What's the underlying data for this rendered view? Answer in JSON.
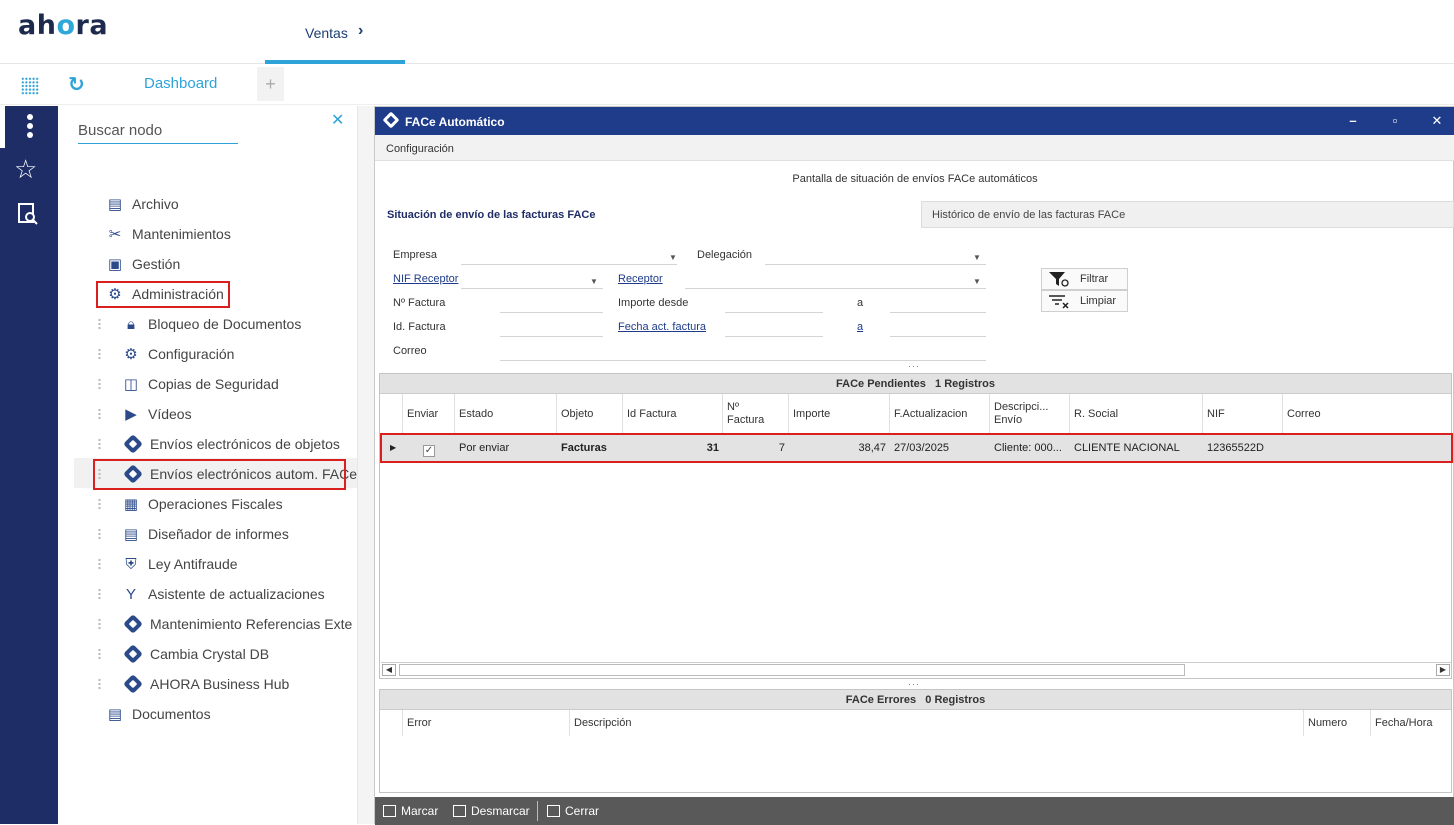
{
  "app": {
    "logo": "ahora"
  },
  "topbar": {
    "tab_label": "Ventas"
  },
  "secbar": {
    "dashboard_label": "Dashboard",
    "add_tab": "+"
  },
  "tree": {
    "search_placeholder": "Buscar nodo",
    "items": [
      {
        "label": "Archivo",
        "icon": "document-icon"
      },
      {
        "label": "Mantenimientos",
        "icon": "tools-icon"
      },
      {
        "label": "Gestión",
        "icon": "clipboard-icon"
      },
      {
        "label": "Administración",
        "icon": "admin-icon"
      },
      {
        "label": "Bloqueo de Documentos",
        "icon": "lock-icon"
      },
      {
        "label": "Configuración",
        "icon": "gear-icon"
      },
      {
        "label": "Copias de Seguridad",
        "icon": "backup-icon"
      },
      {
        "label": "Vídeos",
        "icon": "video-icon"
      },
      {
        "label": "Envíos electrónicos de objetos",
        "icon": "ahora-diamond-icon"
      },
      {
        "label": "Envíos electrónicos autom. FACe",
        "icon": "ahora-diamond-icon"
      },
      {
        "label": "Operaciones Fiscales",
        "icon": "calculator-icon"
      },
      {
        "label": "Diseñador de informes",
        "icon": "report-icon"
      },
      {
        "label": "Ley Antifraude",
        "icon": "antifraud-icon"
      },
      {
        "label": "Asistente de actualizaciones",
        "icon": "fork-icon"
      },
      {
        "label": "Mantenimiento Referencias Externas",
        "icon": "ahora-diamond-icon"
      },
      {
        "label": "Cambia Crystal DB",
        "icon": "ahora-diamond-icon"
      },
      {
        "label": "AHORA Business Hub",
        "icon": "ahora-diamond-icon"
      },
      {
        "label": "Documentos",
        "icon": "document-icon"
      }
    ]
  },
  "window": {
    "title": "FACe Automático",
    "menu": "Configuración",
    "subtitle": "Pantalla de situación de envíos FACe automáticos",
    "tab_active": "Situación de envío de las facturas FACe",
    "tab_other": "Histórico de envío de las facturas FACe",
    "filters": {
      "empresa": "Empresa",
      "delegacion": "Delegación",
      "nif_receptor": "NIF Receptor",
      "receptor": "Receptor",
      "n_factura": "Nº Factura",
      "importe_desde": "Importe desde",
      "a1": "a",
      "id_factura": "Id. Factura",
      "fecha_act": "Fecha act. factura",
      "a2": "a",
      "correo": "Correo",
      "filtrar": "Filtrar",
      "limpiar": "Limpiar"
    },
    "pendientes": {
      "title": "FACe Pendientes",
      "count": "1 Registros",
      "columns": [
        "Enviar",
        "Estado",
        "Objeto",
        "Id Factura",
        "Nº Factura",
        "Importe",
        "F.Actualizacion",
        "Descripción Envío",
        "R. Social",
        "NIF",
        "Correo"
      ],
      "column_labels": [
        "Enviar",
        "Estado",
        "Objeto",
        "Id Factura",
        "Nº\nFactura",
        "Importe",
        "F.Actualizacion",
        "Descripci...\nEnvío",
        "R. Social",
        "NIF",
        "Correo"
      ],
      "rows": [
        {
          "enviar": "✓",
          "estado": "Por enviar",
          "objeto": "Facturas",
          "id_factura": "31",
          "n_factura": "7",
          "importe": "38,47",
          "f_actualizacion": "27/03/2025",
          "descripcion": "Cliente: 000...",
          "r_social": "CLIENTE NACIONAL",
          "nif": "12365522D",
          "correo": ""
        }
      ]
    },
    "errores": {
      "title": "FACe Errores",
      "count": "0 Registros",
      "columns": [
        "Error",
        "Descripción",
        "Numero",
        "Fecha/Hora"
      ]
    },
    "bottom": {
      "marcar": "Marcar",
      "desmarcar": "Desmarcar",
      "cerrar": "Cerrar"
    }
  },
  "colors": {
    "navy": "#1e2d66",
    "accent": "#2ea3d8",
    "window_title": "#1e3c8a",
    "highlight": "#d9201f"
  }
}
